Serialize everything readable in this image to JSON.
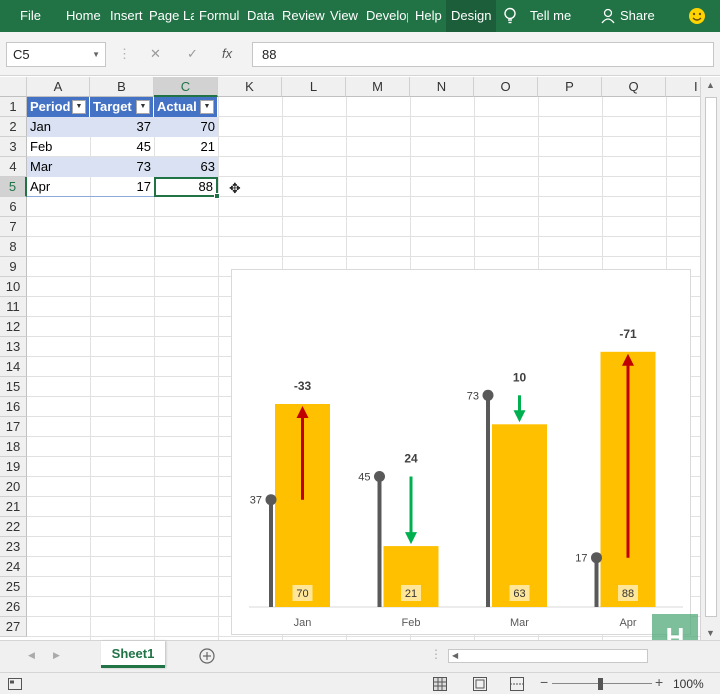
{
  "ribbon": {
    "tabs": [
      {
        "label": "File",
        "name": "tab-file"
      },
      {
        "label": "Home",
        "name": "tab-home"
      },
      {
        "label": "Insert",
        "name": "tab-insert"
      },
      {
        "label": "Page La",
        "name": "tab-page-layout"
      },
      {
        "label": "Formul",
        "name": "tab-formulas"
      },
      {
        "label": "Data",
        "name": "tab-data"
      },
      {
        "label": "Review",
        "name": "tab-review"
      },
      {
        "label": "View",
        "name": "tab-view"
      },
      {
        "label": "Develop",
        "name": "tab-developer"
      },
      {
        "label": "Help",
        "name": "tab-help"
      },
      {
        "label": "Design",
        "name": "tab-design"
      }
    ],
    "tell_me": "Tell me",
    "share": "Share",
    "icons": {
      "tell_me": "lightbulb-icon",
      "share": "person-icon",
      "feedback": "smiley-icon"
    }
  },
  "formula_bar": {
    "name_box": "C5",
    "fx_label": "fx",
    "value": "88",
    "icons": {
      "cancel": "cancel-icon",
      "enter": "check-icon"
    }
  },
  "columns": [
    "A",
    "B",
    "C",
    "K",
    "L",
    "M",
    "N",
    "O",
    "P",
    "Q",
    "I"
  ],
  "rows": [
    "1",
    "2",
    "3",
    "4",
    "5",
    "6",
    "7",
    "8",
    "9",
    "10",
    "11",
    "12",
    "13",
    "14",
    "15",
    "16",
    "17",
    "18",
    "19",
    "20",
    "21",
    "22",
    "23",
    "24",
    "25",
    "26",
    "27"
  ],
  "table": {
    "headers": [
      "Period",
      "Target",
      "Actual"
    ],
    "rows": [
      [
        "Jan",
        "37",
        "70"
      ],
      [
        "Feb",
        "45",
        "21"
      ],
      [
        "Mar",
        "73",
        "63"
      ],
      [
        "Apr",
        "17",
        "88"
      ]
    ]
  },
  "chart_data": {
    "type": "bar",
    "categories": [
      "Jan",
      "Feb",
      "Mar",
      "Apr"
    ],
    "series": [
      {
        "values": [
          70,
          21,
          63,
          88
        ]
      },
      {
        "values": [
          37,
          45,
          73,
          17
        ]
      }
    ],
    "variance_labels": [
      "-33",
      "24",
      "10",
      "-71"
    ],
    "ylim": [
      0,
      100
    ],
    "grid": false,
    "colors": {
      "actual": "#ffc000",
      "target": "#595959",
      "up_arrow": "#c00000",
      "down_arrow": "#00b050"
    }
  },
  "sheet_tabs": [
    "Sheet1"
  ],
  "status": {
    "zoom": "100%",
    "icons": [
      "normal-view-icon",
      "page-layout-view-icon",
      "page-break-view-icon"
    ]
  },
  "colors": {
    "accent": "#217346",
    "table_header": "#4472c4",
    "table_band": "#d9e1f2"
  }
}
